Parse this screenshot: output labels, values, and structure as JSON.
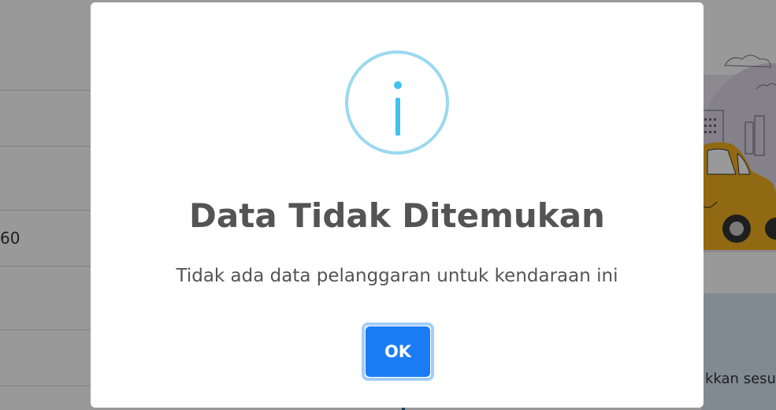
{
  "background": {
    "table_cell_value": "60",
    "panel_text_fragment": "kkan sesu"
  },
  "dialog": {
    "icon": "info-icon",
    "icon_color": "#3fc3ee",
    "ring_color": "#9ad9ef",
    "title": "Data Tidak Ditemukan",
    "message": "Tidak ada data pelanggaran untuk kendaraan ini",
    "ok_label": "OK",
    "ok_color": "#1a7cf5"
  }
}
